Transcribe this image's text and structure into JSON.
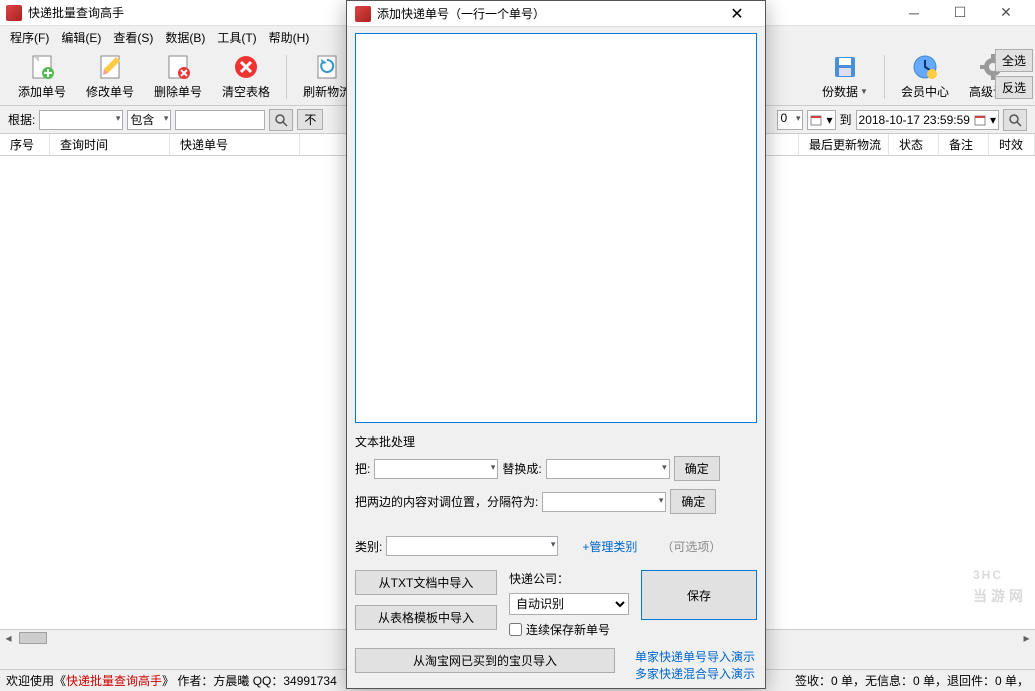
{
  "window": {
    "title": "快递批量查询高手"
  },
  "menubar": [
    {
      "label": "程序(F)"
    },
    {
      "label": "编辑(E)"
    },
    {
      "label": "查看(S)"
    },
    {
      "label": "数据(B)"
    },
    {
      "label": "工具(T)"
    },
    {
      "label": "帮助(H)"
    }
  ],
  "toolbar": {
    "add": "添加单号",
    "edit": "修改单号",
    "del": "删除单号",
    "clear": "清空表格",
    "refresh": "刷新物流",
    "backup": "份数据",
    "member": "会员中心",
    "advanced": "高级设置",
    "selectAll": "全选",
    "invert": "反选"
  },
  "filter": {
    "basis": "根据:",
    "contain": "包含",
    "not": "不",
    "spin": "0",
    "to": "到",
    "date": "2018-10-17 23:59:59"
  },
  "columns": [
    "序号",
    "查询时间",
    "快递单号",
    "最后更新物流",
    "状态",
    "备注",
    "时效"
  ],
  "dialog": {
    "title": "添加快递单号（一行一个单号）",
    "textBatch": "文本批处理",
    "replaceLabel": "把:",
    "replaceTo": "替换成:",
    "ok": "确定",
    "swapLabel": "把两边的内容对调位置，分隔符为:",
    "category": "类别:",
    "addCategory": "+管理类别",
    "optional": "（可选项）",
    "importTxt": "从TXT文档中导入",
    "importSheet": "从表格模板中导入",
    "importTaobao": "从淘宝网已买到的宝贝导入",
    "company": "快递公司：",
    "autoDetect": "自动识别",
    "keepSaving": "连续保存新单号",
    "save": "保存",
    "demo1": "单家快递单号导入演示",
    "demo2": "多家快递混合导入演示"
  },
  "status": {
    "welcome1": "欢迎使用《",
    "welcome2": "快递批量查询高手",
    "welcome3": "》  作者：方晨曦    QQ：34991734",
    "right": "签收：0 单，无信息：0 单，退回件：0 单，"
  },
  "watermark": {
    "big": "3HC",
    "small": "当游网"
  }
}
